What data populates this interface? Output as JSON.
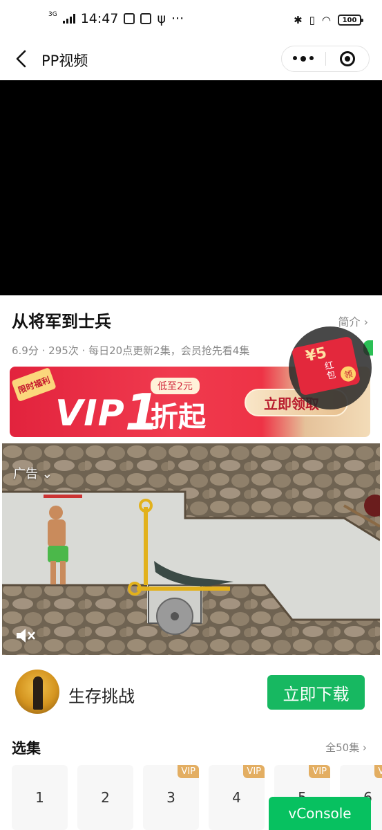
{
  "status_bar": {
    "network": "3G",
    "time": "14:47",
    "battery": "100"
  },
  "nav": {
    "title": "PP视频"
  },
  "show": {
    "title": "从将军到士兵",
    "intro_label": "简介",
    "meta": "6.9分 · 295次 · 每日20点更新2集，会员抢先看4集"
  },
  "vip_banner": {
    "tag": "限时福利",
    "vip_text": "VIP",
    "vip_num": "1",
    "low_badge": "低至2元",
    "discount_text": "折起",
    "button_label": "立即领取"
  },
  "red_packet": {
    "amount": "¥5",
    "label": "红包",
    "get": "领"
  },
  "ad": {
    "label": "广告",
    "level_progress": 0.9
  },
  "app": {
    "name": "生存挑战",
    "download_label": "立即下载"
  },
  "episodes": {
    "header": "选集",
    "all_label": "全50集",
    "items": [
      {
        "num": "1",
        "vip": ""
      },
      {
        "num": "2",
        "vip": ""
      },
      {
        "num": "3",
        "vip": "VIP"
      },
      {
        "num": "4",
        "vip": "VIP"
      },
      {
        "num": "5",
        "vip": "VIP"
      },
      {
        "num": "6",
        "vip": "VIP"
      }
    ]
  },
  "vconsole": {
    "label": "vConsole"
  },
  "colors": {
    "accent_green": "#17b861",
    "vconsole_green": "#07c160",
    "vip_red": "#e2233d",
    "vip_gold": "#e3ae62"
  }
}
